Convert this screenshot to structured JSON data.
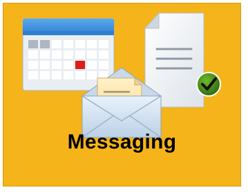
{
  "tile": {
    "label": "Messaging",
    "background_color": "#f4b41a",
    "icons": [
      "calendar-icon",
      "document-icon",
      "check-badge-icon",
      "envelope-icon"
    ],
    "calendar_highlight_color": "#e01b1b",
    "check_badge_color": "#3f7a16"
  }
}
